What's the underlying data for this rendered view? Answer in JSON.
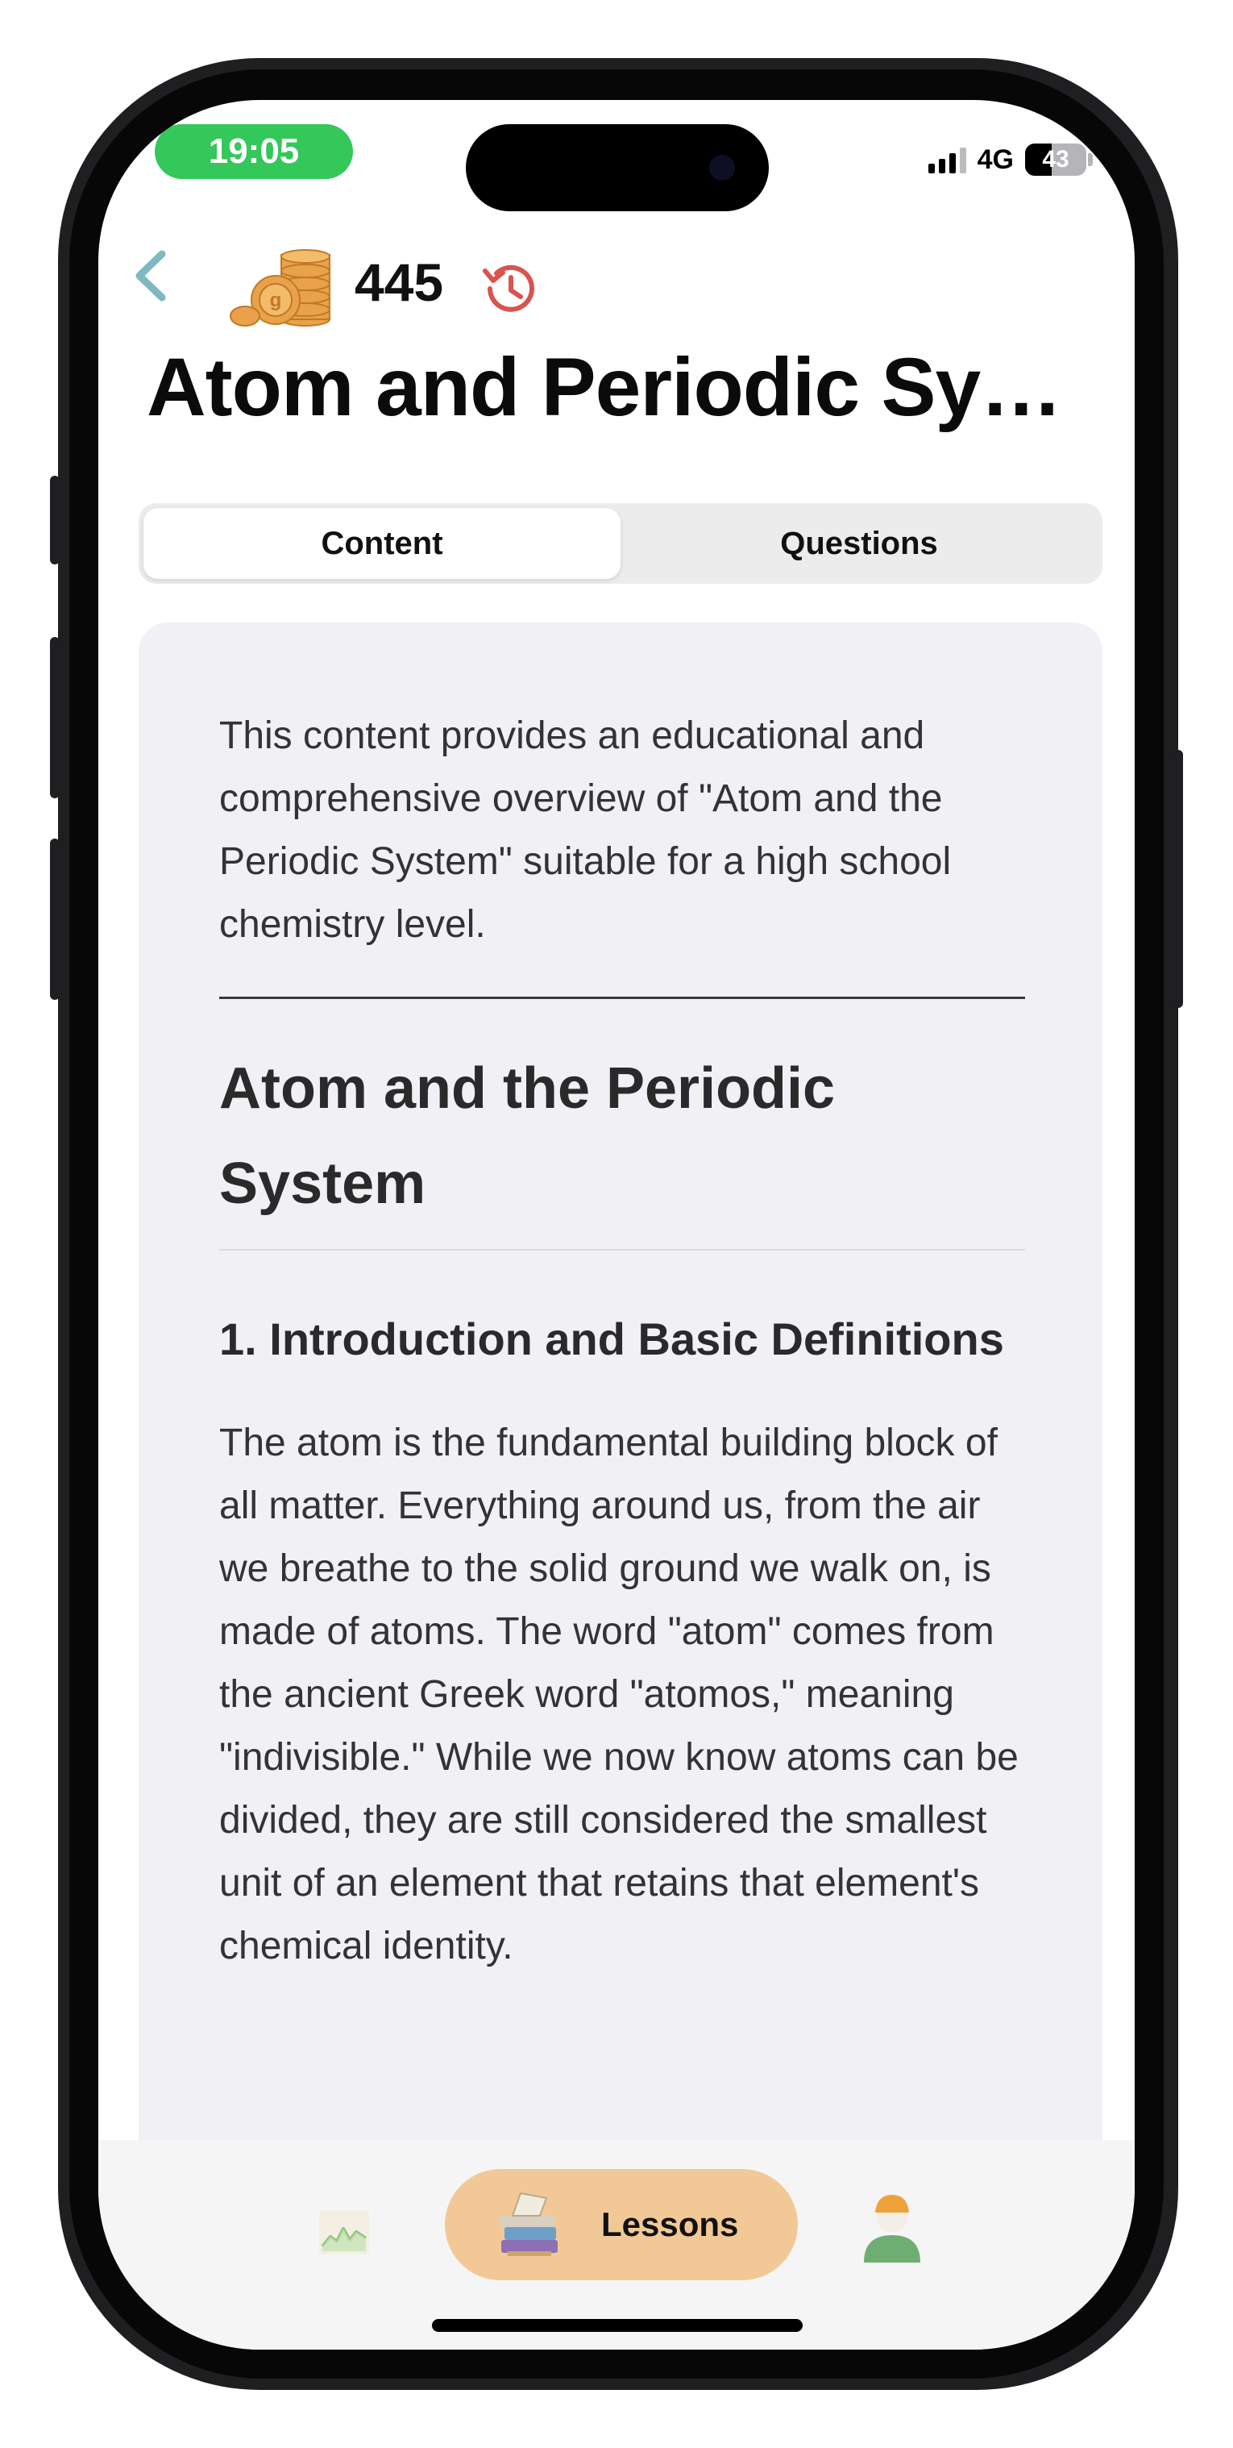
{
  "status_bar": {
    "time": "19:05",
    "network": "4G",
    "battery": "43",
    "battery_level": 0.43
  },
  "header": {
    "back_icon": "chevron-left-icon",
    "coins_icon": "coin-stack-icon",
    "coins": "445",
    "history_icon": "history-icon",
    "title": "Atom and Periodic Sy…"
  },
  "tabs": [
    {
      "label": "Content",
      "active": true
    },
    {
      "label": "Questions",
      "active": false
    }
  ],
  "content": {
    "intro": "This content provides an educational and comprehensive overview of \"Atom and the Periodic System\" suitable for a high school chemistry level.",
    "heading": "Atom and the Periodic System",
    "section_heading": "1. Introduction and Basic Definitions",
    "section_text": "The atom is the fundamental building block of all matter. Everything around us, from the air we breathe to the solid ground we walk on, is made of atoms. The word \"atom\" comes from the ancient Greek word \"atomos,\" meaning \"indivisible.\" While we now know atoms can be divided, they are still considered the smallest unit of an element that retains that element's chemical identity."
  },
  "tab_bar": {
    "stats_icon": "chart-icon",
    "lessons_icon": "books-icon",
    "lessons_label": "Lessons",
    "profile_icon": "profile-icon"
  },
  "colors": {
    "time_pill": "#34c759",
    "back": "#7fb8c0",
    "history": "#d9534f",
    "lessons_pill": "#f2c996",
    "content_bg": "#f1f1f5"
  }
}
